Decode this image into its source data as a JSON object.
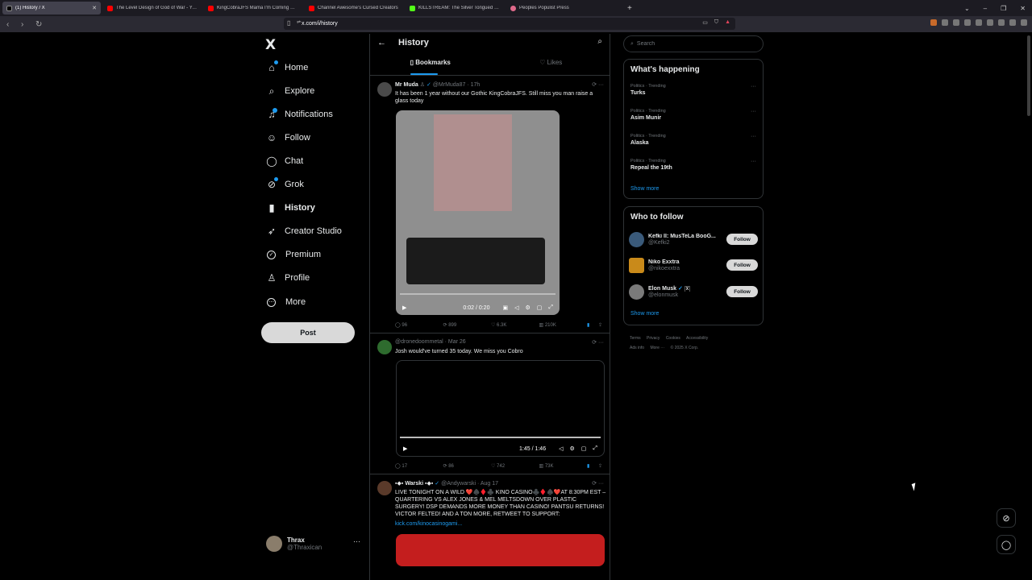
{
  "browser": {
    "tabs": [
      {
        "label": "(1) History / X",
        "color": "#42414d"
      },
      {
        "label": "The Level Design of God of War - YouTube",
        "color": "#ff0000"
      },
      {
        "label": "KingCobraJFS Mama I'm Coming Home",
        "color": "#ff0000"
      },
      {
        "label": "Channel Awesome's Cursed Creators",
        "color": "#ff0000"
      },
      {
        "label": "KILLSTREAM: The Silver Tongued De",
        "color": "#53fc18"
      },
      {
        "label": "Peoples Populist Press",
        "color": "#e06a8b"
      }
    ],
    "new_tab": "+",
    "url": "x.com/i/history"
  },
  "nav": {
    "logo": "X",
    "items": [
      {
        "label": "Home",
        "icon": "home-icon",
        "glyph": "⌂"
      },
      {
        "label": "Explore",
        "icon": "search-icon",
        "glyph": "⌕"
      },
      {
        "label": "Notifications",
        "icon": "bell-icon",
        "glyph": "♫"
      },
      {
        "label": "Follow",
        "icon": "follow-icon",
        "glyph": "☺"
      },
      {
        "label": "Chat",
        "icon": "chat-icon",
        "glyph": "◯"
      },
      {
        "label": "Grok",
        "icon": "grok-icon",
        "glyph": "⊘"
      },
      {
        "label": "History",
        "icon": "bookmark-icon",
        "glyph": "▮"
      },
      {
        "label": "Creator Studio",
        "icon": "rocket-icon",
        "glyph": "➶"
      },
      {
        "label": "Premium",
        "icon": "premium-icon",
        "glyph": "✓"
      },
      {
        "label": "Profile",
        "icon": "profile-icon",
        "glyph": "♙"
      },
      {
        "label": "More",
        "icon": "more-icon",
        "glyph": "⋯"
      }
    ],
    "post_label": "Post",
    "account": {
      "name": "Thrax",
      "handle": "@Thraxican",
      "menu": "···"
    }
  },
  "main": {
    "title": "History",
    "tabs": [
      "Bookmarks",
      "Likes"
    ],
    "tweets": [
      {
        "name": "Mr Muda",
        "handle": "@MrMuda87",
        "time": "17h",
        "text": "It has been 1 year without our Gothic KingCobraJFS. Still miss you man raise a glass today",
        "video_time": "0:02 / 0:20",
        "replies": "96",
        "reposts": "899",
        "likes": "6.3K",
        "views": "210K"
      },
      {
        "name": "",
        "handle": "@dronedoommetal",
        "time": "Mar 26",
        "text": "Josh would've turned 35 today. We miss you Cobro",
        "video_time": "1:45 / 1:46",
        "replies": "17",
        "reposts": "86",
        "likes": "742",
        "views": "73K"
      },
      {
        "name": "Warski",
        "handle": "@Andywarski",
        "time": "Aug 17",
        "text": "LIVE TONIGHT ON A WILD ❤️♠️♦️♣️ KINO CASINO♣️♦️♠️❤️AT 8:30PM EST – QUARTERING VS ALEX JONES & MEL MELTSDOWN OVER PLASTIC SURGERY! DSP DEMANDS MORE MONEY THAN CASINO! PANTSU RETURNS! VICTOR FELTED! AND A TON MORE, RETWEET TO SUPPORT:",
        "link": "kick.com/kinocasinogami..."
      }
    ]
  },
  "right": {
    "search_placeholder": "Search",
    "trending_title": "What's happening",
    "trends": [
      {
        "meta": "Politics · Trending",
        "title": "Turks"
      },
      {
        "meta": "Politics · Trending",
        "title": "Asim Munir"
      },
      {
        "meta": "Politics · Trending",
        "title": "Alaska"
      },
      {
        "meta": "Politics · Trending",
        "title": "Repeal the 19th"
      }
    ],
    "show_more": "Show more",
    "wtf_title": "Who to follow",
    "follow": [
      {
        "name": "Kefki II: MusTeLa BooG...",
        "handle": "@Kefki2",
        "color": "#3a5a7a"
      },
      {
        "name": "Niko Exxtra",
        "handle": "@nikoexxtra",
        "color": "#c98a1a"
      },
      {
        "name": "Elon Musk",
        "handle": "@elonmusk",
        "color": "#7a7a7a"
      }
    ],
    "follow_label": "Follow",
    "footer": [
      "Terms",
      "Privacy",
      "Cookies",
      "Accessibility",
      "Ads info",
      "More ···",
      "© 2025 X Corp."
    ]
  },
  "colors": {
    "accent": "#1d9bf0",
    "bg": "#000000",
    "border": "#2f3336"
  }
}
